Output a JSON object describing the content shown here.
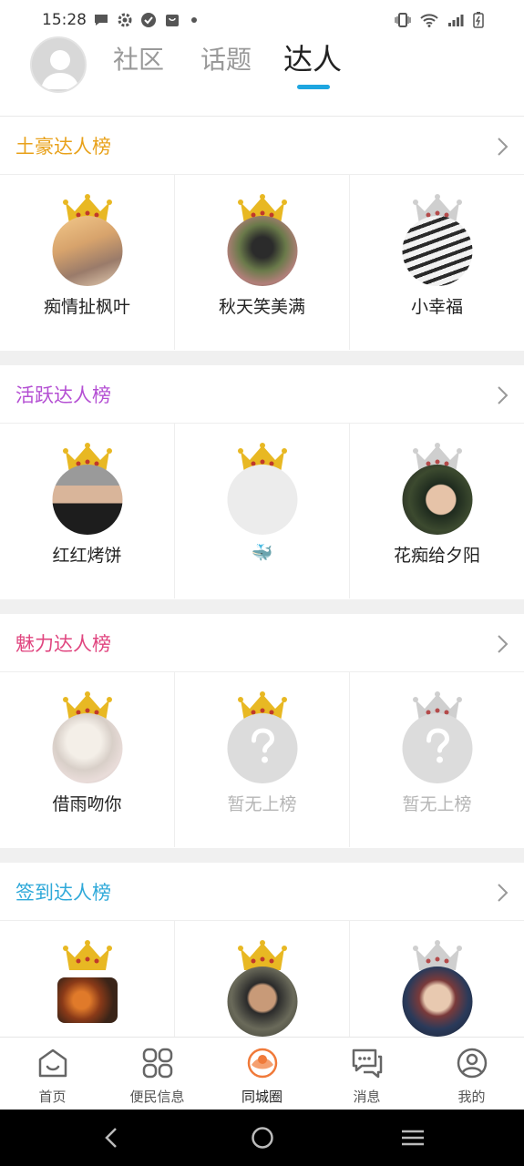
{
  "status": {
    "time": "15:28"
  },
  "header": {
    "tabs": [
      {
        "label": "社区",
        "active": false
      },
      {
        "label": "话题",
        "active": false
      },
      {
        "label": "达人",
        "active": true
      }
    ]
  },
  "colors": {
    "accent": "#1ea6e0",
    "gold": "#e8b823",
    "silver": "#cfcfcf"
  },
  "sections": [
    {
      "title": "土豪达人榜",
      "color": "#e8a11a",
      "users": [
        {
          "name": "痴情扯枫叶",
          "crown": "gold",
          "avatar": "photo"
        },
        {
          "name": "秋天笑美满",
          "crown": "gold",
          "avatar": "photo"
        },
        {
          "name": "小幸福",
          "crown": "silver",
          "avatar": "photo"
        }
      ]
    },
    {
      "title": "活跃达人榜",
      "color": "#b44fd3",
      "users": [
        {
          "name": "红红烤饼",
          "crown": "gold",
          "avatar": "photo"
        },
        {
          "name": "🐳",
          "crown": "gold",
          "avatar": "blank"
        },
        {
          "name": "花痴给夕阳",
          "crown": "silver",
          "avatar": "photo"
        }
      ]
    },
    {
      "title": "魅力达人榜",
      "color": "#e0457f",
      "users": [
        {
          "name": "借雨吻你",
          "crown": "gold",
          "avatar": "photo"
        },
        {
          "name": "暂无上榜",
          "crown": "gold",
          "avatar": "unknown"
        },
        {
          "name": "暂无上榜",
          "crown": "silver",
          "avatar": "unknown"
        }
      ]
    },
    {
      "title": "签到达人榜",
      "color": "#2fa9d9",
      "users": [
        {
          "name": "",
          "crown": "gold",
          "avatar": "photo"
        },
        {
          "name": "",
          "crown": "gold",
          "avatar": "photo"
        },
        {
          "name": "",
          "crown": "silver",
          "avatar": "photo"
        }
      ]
    }
  ],
  "bottom_nav": [
    {
      "label": "首页",
      "icon": "home-icon"
    },
    {
      "label": "便民信息",
      "icon": "grid-icon"
    },
    {
      "label": "同城圈",
      "icon": "circle-icon",
      "active": true
    },
    {
      "label": "消息",
      "icon": "chat-icon"
    },
    {
      "label": "我的",
      "icon": "profile-icon"
    }
  ]
}
